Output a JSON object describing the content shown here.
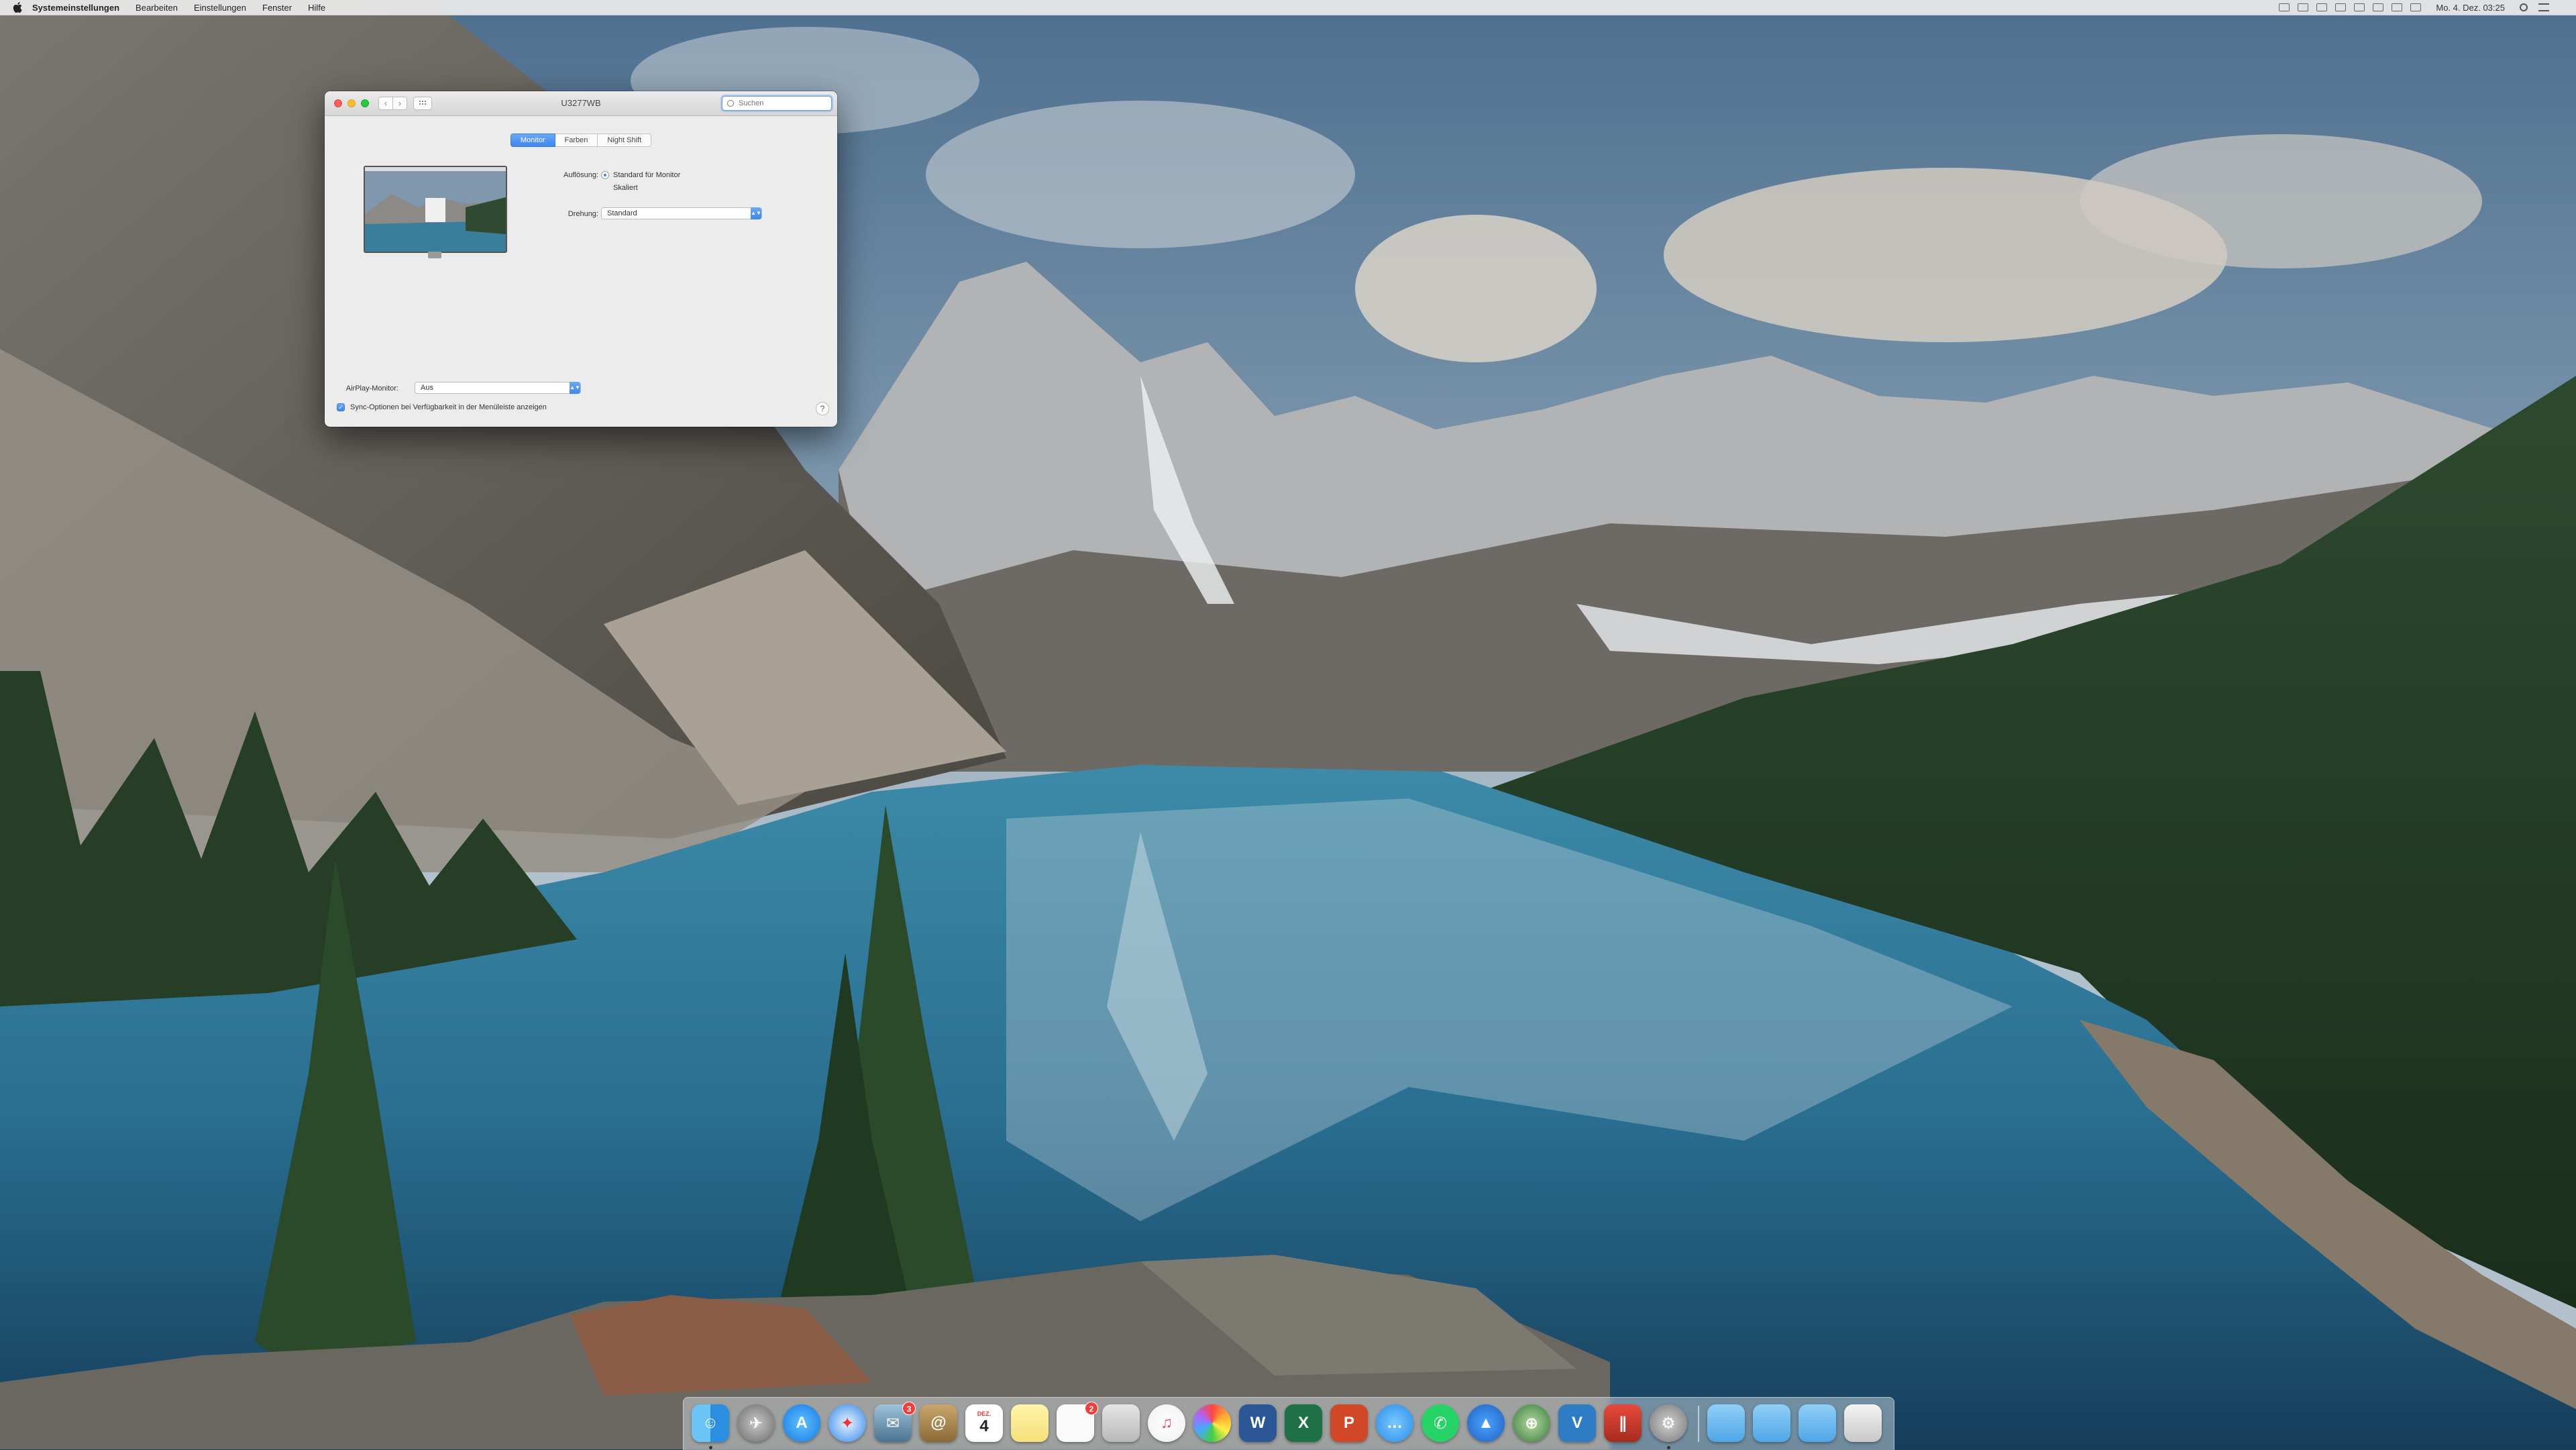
{
  "menubar": {
    "app_name": "Systemeinstellungen",
    "items": [
      "Bearbeiten",
      "Einstellungen",
      "Fenster",
      "Hilfe"
    ],
    "clock": "Mo. 4. Dez.  03:25"
  },
  "window": {
    "title": "U3277WB",
    "search_placeholder": "Suchen",
    "tabs": [
      "Monitor",
      "Farben",
      "Night Shift"
    ],
    "active_tab": "Monitor",
    "resolution_label": "Auflösung:",
    "resolution_default": "Standard für Monitor",
    "resolution_scaled": "Skaliert",
    "rotation_label": "Drehung:",
    "rotation_value": "Standard",
    "airplay_label": "AirPlay-Monitor:",
    "airplay_value": "Aus",
    "mirror_option": "Sync-Optionen bei Verfügbarkeit in der Menüleiste anzeigen",
    "help": "?"
  },
  "dock": {
    "badges": {
      "mail": "3",
      "reminders": "2"
    },
    "calendar_month": "DEZ.",
    "calendar_day": "4"
  },
  "colors": {
    "accent": "#3e86f0",
    "menubar_bg": "#ececec",
    "window_bg": "#ececec"
  }
}
